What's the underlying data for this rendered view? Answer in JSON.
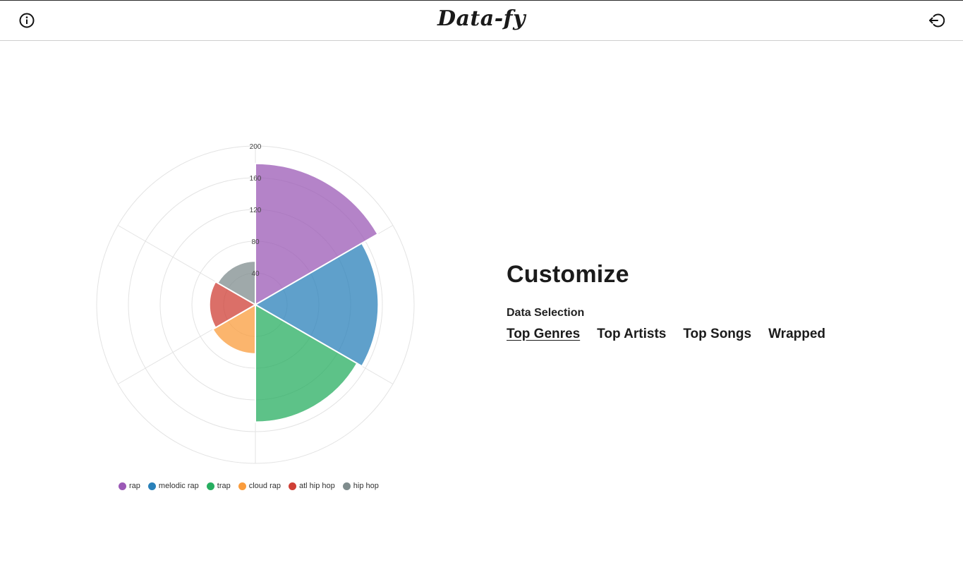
{
  "header": {
    "logo": "Data-fy",
    "info_icon": "info-icon",
    "logout_icon": "logout-icon"
  },
  "chart_data": {
    "type": "polar-area",
    "series": [
      {
        "label": "rap",
        "value": 178,
        "color": "#9b59b6"
      },
      {
        "label": "melodic rap",
        "value": 155,
        "color": "#2980b9"
      },
      {
        "label": "trap",
        "value": 148,
        "color": "#27ae60"
      },
      {
        "label": "cloud rap",
        "value": 62,
        "color": "#fa9c3c"
      },
      {
        "label": "atl hip hop",
        "value": 58,
        "color": "#cf3f36"
      },
      {
        "label": "hip hop",
        "value": 55,
        "color": "#7f8c8d"
      }
    ],
    "ticks": [
      40,
      80,
      120,
      160,
      200
    ],
    "rmax": 200,
    "grid": true,
    "legend_position": "bottom"
  },
  "legend": {
    "items": [
      "rap",
      "melodic rap",
      "trap",
      "cloud rap",
      "atl hip hop",
      "hip hop"
    ]
  },
  "customize": {
    "title": "Customize",
    "subtitle": "Data Selection",
    "tabs": [
      {
        "label": "Top Genres",
        "active": true
      },
      {
        "label": "Top Artists",
        "active": false
      },
      {
        "label": "Top Songs",
        "active": false
      },
      {
        "label": "Wrapped",
        "active": false
      }
    ]
  }
}
